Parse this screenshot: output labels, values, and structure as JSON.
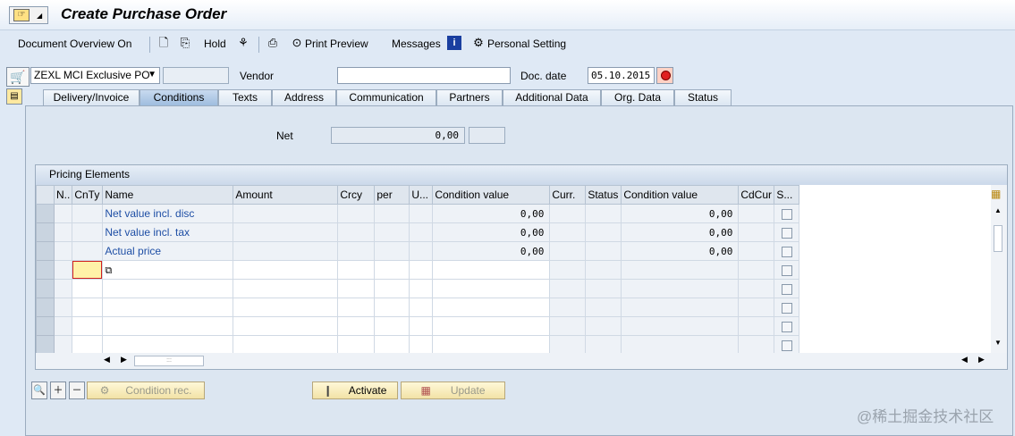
{
  "header": {
    "title": "Create Purchase Order"
  },
  "toolbar": {
    "document_overview": "Document Overview On",
    "hold": "Hold",
    "print_preview": "Print Preview",
    "messages": "Messages",
    "personal_setting": "Personal Setting"
  },
  "po_header": {
    "doc_type": "ZEXL MCI Exclusive PO",
    "vendor_label": "Vendor",
    "vendor_value": "",
    "doc_date_label": "Doc. date",
    "doc_date": "05.10.2015"
  },
  "tabs": [
    {
      "label": "Delivery/Invoice",
      "active": false
    },
    {
      "label": "Conditions",
      "active": true
    },
    {
      "label": "Texts",
      "active": false
    },
    {
      "label": "Address",
      "active": false
    },
    {
      "label": "Communication",
      "active": false
    },
    {
      "label": "Partners",
      "active": false
    },
    {
      "label": "Additional Data",
      "active": false
    },
    {
      "label": "Org. Data",
      "active": false
    },
    {
      "label": "Status",
      "active": false
    }
  ],
  "conditions": {
    "net_label": "Net",
    "net_value": "0,00",
    "pricing_title": "Pricing Elements",
    "columns": [
      "N..",
      "CnTy",
      "Name",
      "Amount",
      "Crcy",
      "per",
      "U...",
      "Condition value",
      "Curr.",
      "Status",
      "Condition value",
      "CdCur",
      "S..."
    ],
    "rows": [
      {
        "name": "Net value incl. disc",
        "cond_value": "0,00",
        "cond_value2": "0,00"
      },
      {
        "name": "Net value incl. tax",
        "cond_value": "0,00",
        "cond_value2": "0,00"
      },
      {
        "name": "Actual price",
        "cond_value": "0,00",
        "cond_value2": "0,00"
      }
    ]
  },
  "buttons": {
    "condition_rec": "Condition rec.",
    "activate": "Activate",
    "update": "Update"
  },
  "watermark": "@稀土掘金技术社区",
  "colors": {
    "accent": "#1f4fa5",
    "panel": "#dce6f1",
    "button": "#f2e2a6"
  }
}
